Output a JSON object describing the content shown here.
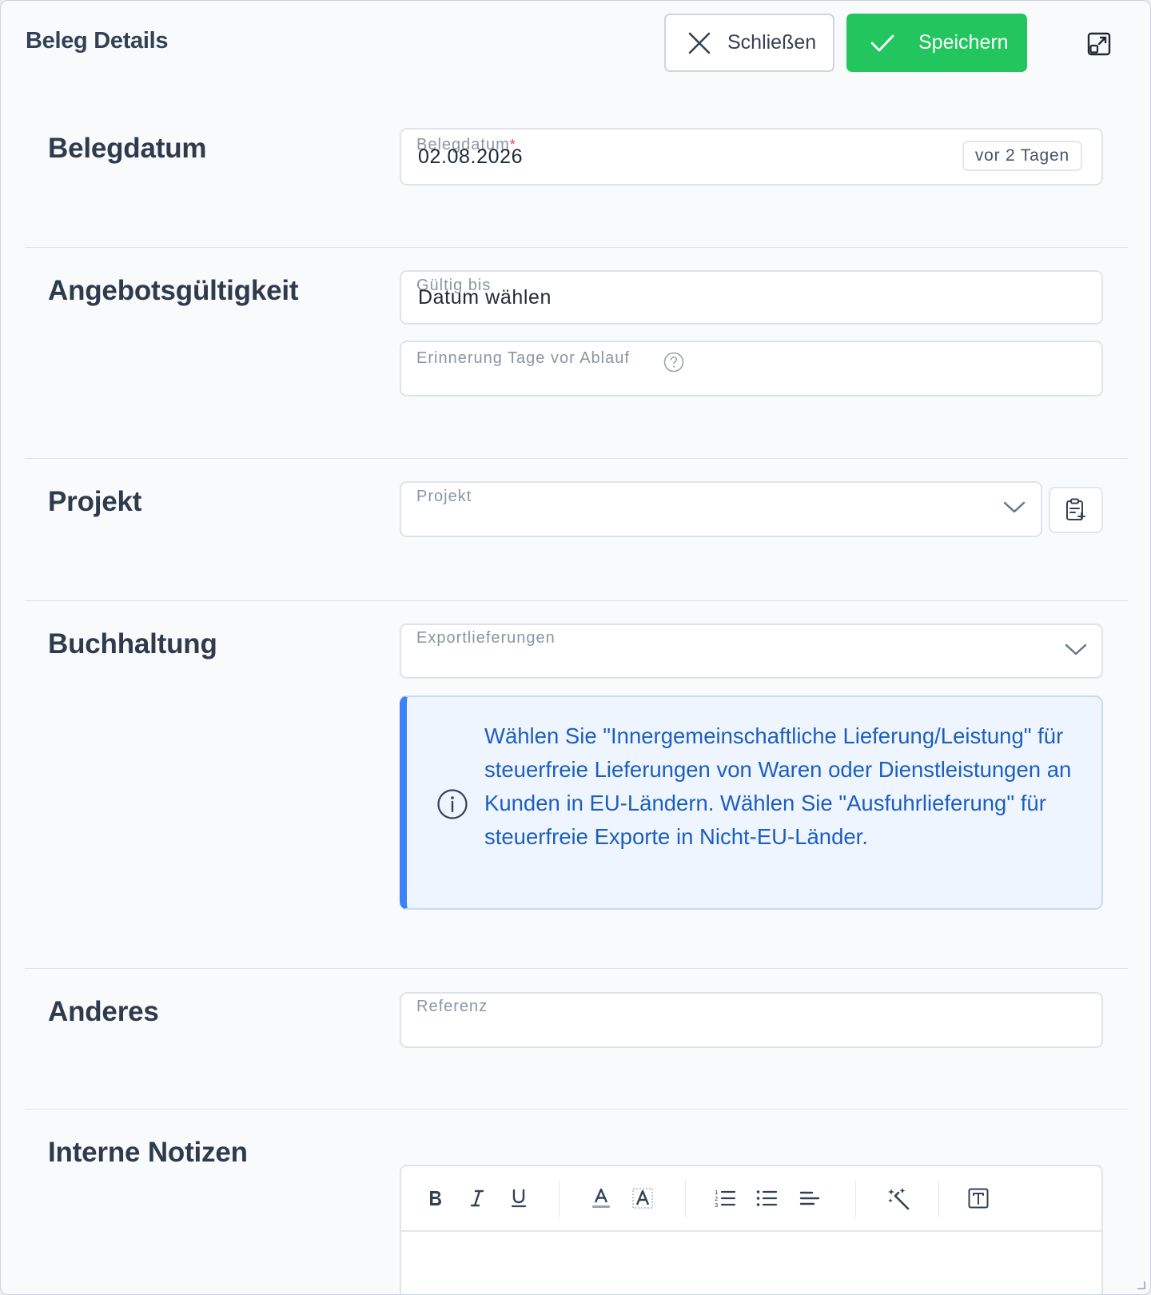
{
  "header": {
    "title": "Beleg Details",
    "close_label": "Schließen",
    "save_label": "Speichern"
  },
  "colors": {
    "save": "#22c55e",
    "info_accent": "#3b82f6",
    "info_text": "#1d5fbf",
    "required": "#ef4444"
  },
  "sections": {
    "belegdatum": {
      "title": "Belegdatum",
      "field_label": "Belegdatum",
      "required_mark": "*",
      "value": "02.08.2026",
      "relative_badge": "vor 2 Tagen"
    },
    "gueltigkeit": {
      "title": "Angebotsgültigkeit",
      "valid_until_label": "Gültig bis",
      "valid_until_value": "Datum wählen",
      "reminder_label": "Erinnerung Tage vor Ablauf"
    },
    "projekt": {
      "title": "Projekt",
      "field_label": "Projekt"
    },
    "buchhaltung": {
      "title": "Buchhaltung",
      "field_label": "Exportlieferungen",
      "info_text": "Wählen Sie \"Innergemeinschaftliche Lieferung/Leistung\" für steuerfreie Lieferungen von Waren oder Dienstleistungen an Kunden in EU-Ländern. Wählen Sie \"Ausfuhrlieferung\" für steuerfreie Exporte in Nicht-EU-Länder."
    },
    "anderes": {
      "title": "Anderes",
      "field_label": "Referenz"
    },
    "notizen": {
      "title": "Interne Notizen",
      "toolbar": [
        "bold-icon",
        "italic-icon",
        "underline-icon",
        "text-color-icon",
        "highlight-icon",
        "ordered-list-icon",
        "bullet-list-icon",
        "align-left-icon",
        "magic-wand-icon",
        "text-box-icon"
      ]
    }
  }
}
